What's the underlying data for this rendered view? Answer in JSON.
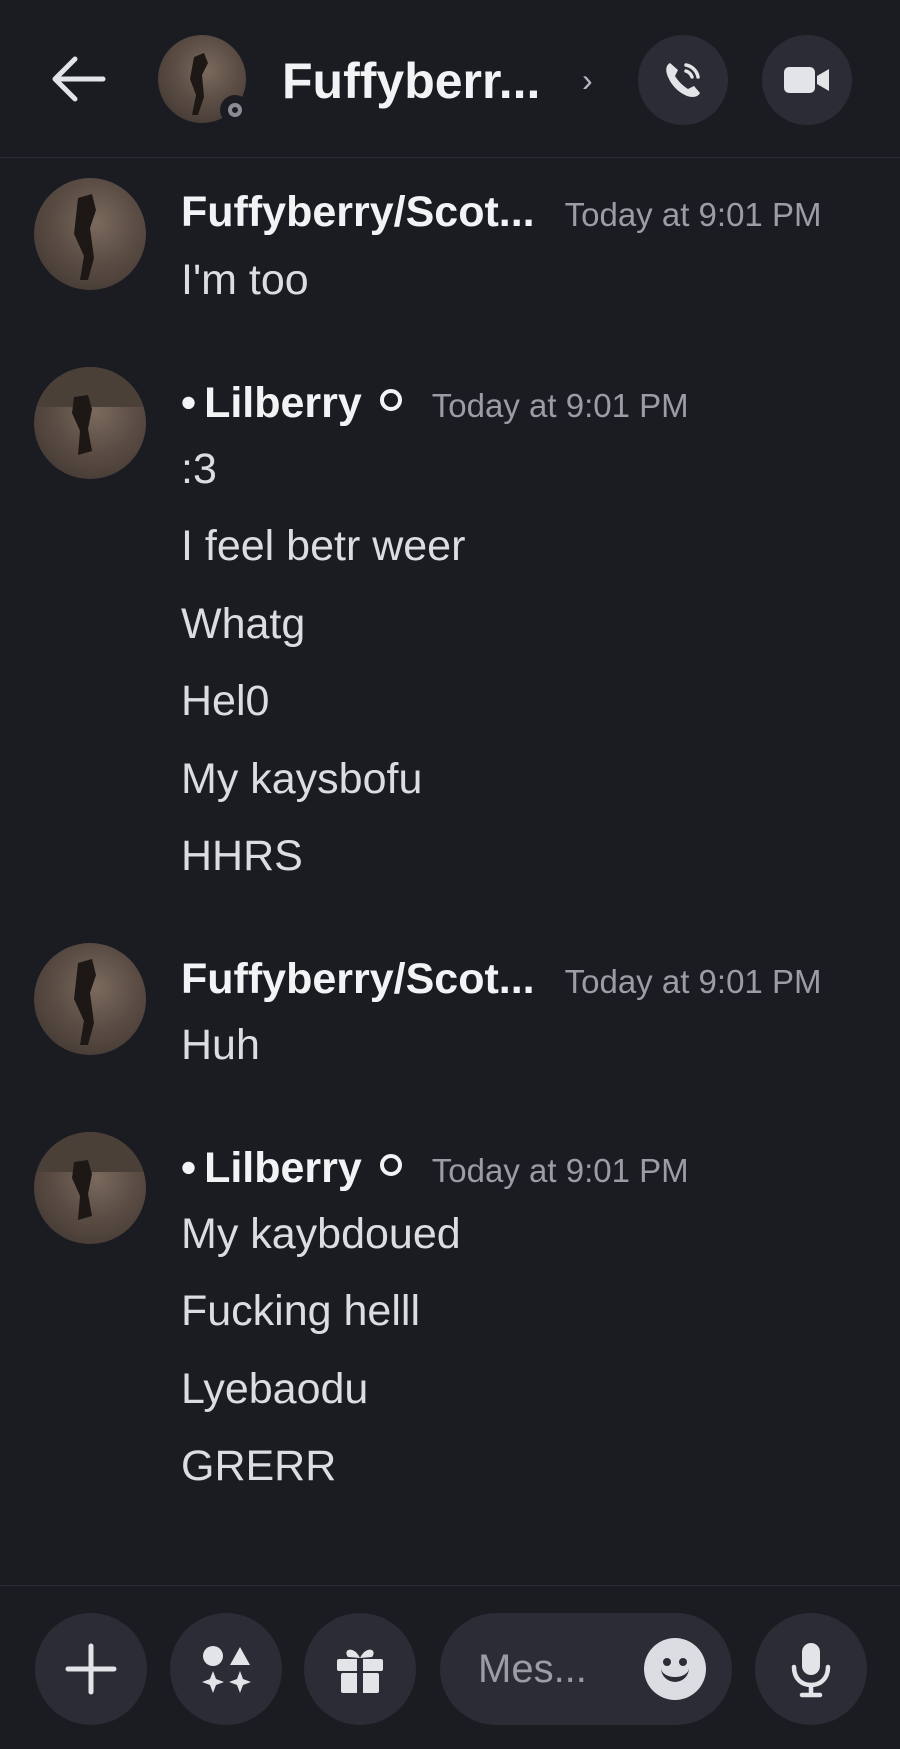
{
  "header": {
    "title": "Fuffyberr...",
    "chevron": "›",
    "icons": {
      "back": "arrow-left-icon",
      "call": "phone-call-icon",
      "video": "video-camera-icon"
    },
    "status": "offline"
  },
  "messages": [
    {
      "author": "Fuffyberry/Scot...",
      "bullet": "",
      "timestamp": "Today at 9:01 PM",
      "lines": [
        "I'm too"
      ]
    },
    {
      "author": "Lilberry",
      "bullet": "•",
      "timestamp": "Today at 9:01 PM",
      "lines": [
        ":3",
        "I feel betr weer",
        "Whatg",
        "Hel0",
        "My kaysbofu",
        "HHRS"
      ]
    },
    {
      "author": "Fuffyberry/Scot...",
      "bullet": "",
      "timestamp": "Today at 9:01 PM",
      "lines": [
        "Huh"
      ]
    },
    {
      "author": "Lilberry",
      "bullet": "•",
      "timestamp": "Today at 9:01 PM",
      "lines": [
        "My kaybdoued",
        "Fucking helll",
        "Lyebaodu",
        "GRERR"
      ]
    }
  ],
  "composer": {
    "placeholder": "Mes...",
    "icons": {
      "plus": "plus-icon",
      "apps": "apps-icon",
      "gift": "gift-icon",
      "emoji": "emoji-icon",
      "mic": "microphone-icon"
    }
  },
  "colors": {
    "background": "#1b1c22",
    "button": "#2b2c35",
    "text": "#dcdde2",
    "muted": "#9a9ca6"
  }
}
